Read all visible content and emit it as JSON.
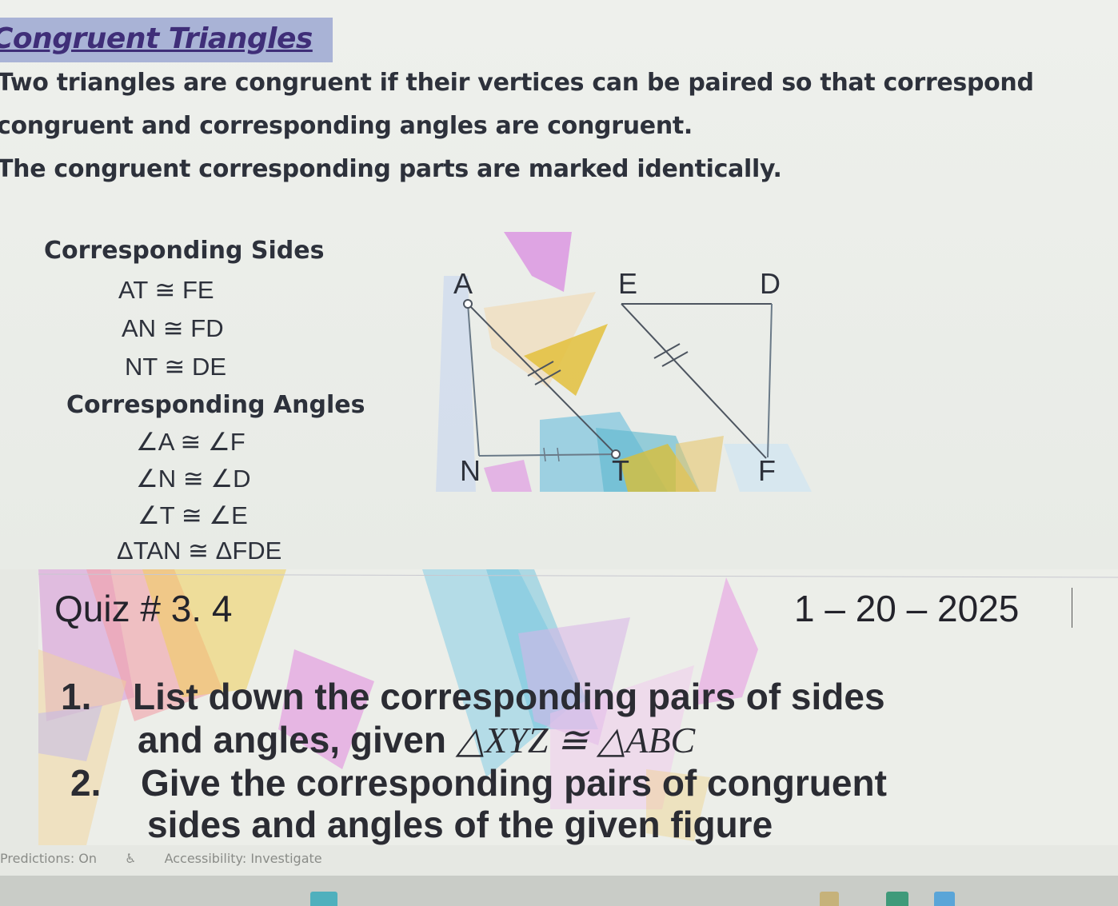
{
  "document": {
    "title": "Congruent Triangles",
    "definition_lines": [
      "Two triangles are congruent if their vertices can be paired so that correspond",
      "congruent and corresponding angles are congruent.",
      "The congruent corresponding parts are marked identically."
    ],
    "sides_heading": "Corresponding Sides",
    "sides": [
      "AT ≅ FE",
      "AN ≅ FD",
      "NT ≅ DE"
    ],
    "angles_heading": "Corresponding Angles",
    "angles": [
      "∠A ≅ ∠F",
      "∠N ≅ ∠D",
      "∠T ≅ ∠E"
    ],
    "triangle_congruence": "ΔTAN ≅ ΔFDE",
    "diagram": {
      "triangle1_labels": [
        "A",
        "N",
        "T"
      ],
      "triangle2_labels": [
        "E",
        "D",
        "F"
      ]
    }
  },
  "quiz_slide": {
    "title": "Quiz # 3. 4",
    "date": "1 – 20 – 2025",
    "q1_number": "1.",
    "q1_line1": "List down the corresponding pairs of sides",
    "q1_line2_prefix": "and angles, given ",
    "q1_math": "△XYZ  ≅  △ABC",
    "q2_number": "2.",
    "q2_line1": "Give the corresponding pairs of congruent",
    "q2_line2": "sides and angles of the given figure"
  },
  "status_bar": {
    "predictions": "Predictions: On",
    "accessibility": "Accessibility: Investigate"
  }
}
